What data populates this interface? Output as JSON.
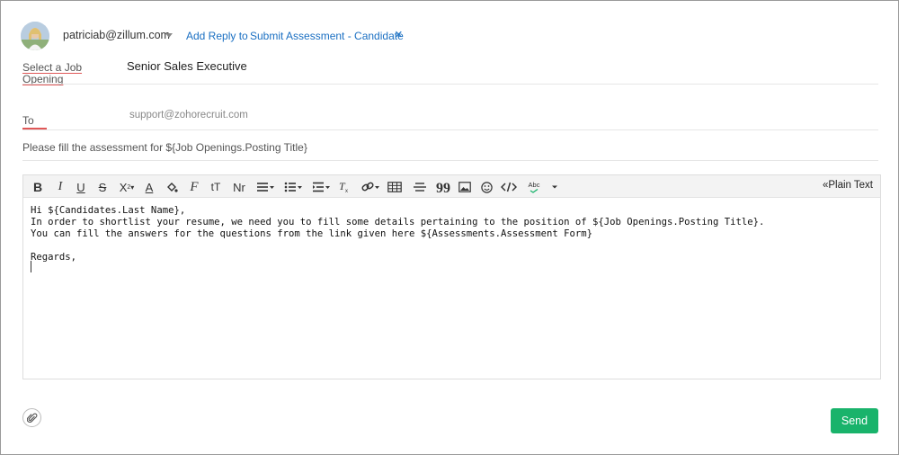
{
  "header": {
    "from_email": "patriciab@zillum.com",
    "add_reply_to": "Add Reply to",
    "template_name": "Submit Assessment - Candidate",
    "close_symbol": "×"
  },
  "fields": {
    "job_opening_label": "Select a Job Opening",
    "job_opening_value": "Senior Sales Executive",
    "to_label": "To",
    "to_value": "support@zohorecruit.com",
    "subject": "Please fill the assessment for ${Job Openings.Posting Title}"
  },
  "toolbar": {
    "items": [
      "bold-icon",
      "italic-icon",
      "underline-icon",
      "strikethrough-icon",
      "subscript-icon",
      "font-color-icon",
      "fill-color-icon",
      "font-family-icon",
      "font-size-icon",
      "text-format-icon",
      "align-icon",
      "list-icon",
      "indent-icon",
      "clear-format-icon",
      "link-icon",
      "table-icon",
      "horizontal-rule-icon",
      "quote-icon",
      "image-icon",
      "emoji-icon",
      "code-icon",
      "spellcheck-icon",
      "more-icon"
    ],
    "plain_text": "«Plain Text",
    "bold": "B",
    "italic": "I",
    "underline": "U",
    "strike": "S",
    "subscript": "X",
    "font_color": "A",
    "font_family": "F",
    "font_size": "tT",
    "text_format": "Nr",
    "quote": "99",
    "spell": "Abc"
  },
  "body": {
    "text": "Hi ${Candidates.Last Name},\nIn order to shortlist your resume, we need you to fill some details pertaining to the position of ${Job Openings.Posting Title}.\nYou can fill the answers for the questions from the link given here ${Assessments.Assessment Form}\n\nRegards,"
  },
  "footer": {
    "send_label": "Send"
  },
  "colors": {
    "link": "#1a6fc2",
    "send": "#19b36b",
    "accent_underline": "#e05757"
  }
}
